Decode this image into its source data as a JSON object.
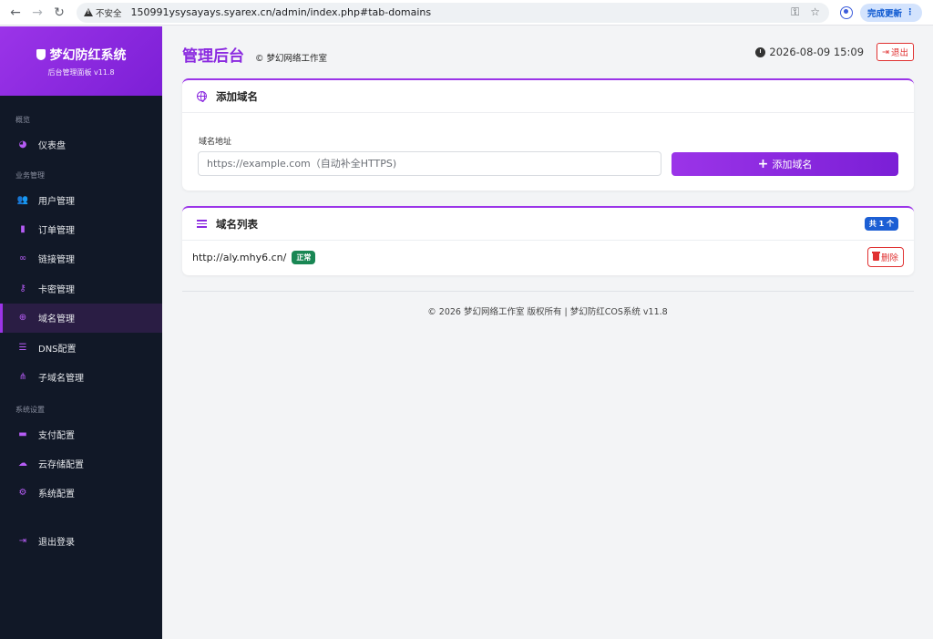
{
  "browser": {
    "insecure_label": "不安全",
    "url": "150991ysysayays.syarex.cn/admin/index.php#tab-domains",
    "update_label": "完成更新"
  },
  "brand": {
    "title": "梦幻防红系统",
    "subtitle": "后台管理面板 v11.8"
  },
  "sidebar": {
    "sections": [
      {
        "label": "概览",
        "items": [
          {
            "label": "仪表盘",
            "icon": "dashboard-icon",
            "glyph": "◕"
          }
        ]
      },
      {
        "label": "业务管理",
        "items": [
          {
            "label": "用户管理",
            "icon": "users-icon",
            "glyph": "👥"
          },
          {
            "label": "订单管理",
            "icon": "order-icon",
            "glyph": "▮"
          },
          {
            "label": "链接管理",
            "icon": "link-icon",
            "glyph": "∞"
          },
          {
            "label": "卡密管理",
            "icon": "key-icon",
            "glyph": "⚷"
          },
          {
            "label": "域名管理",
            "icon": "globe-icon",
            "glyph": "⊕",
            "active": true
          },
          {
            "label": "DNS配置",
            "icon": "server-icon",
            "glyph": "☰"
          },
          {
            "label": "子域名管理",
            "icon": "sitemap-icon",
            "glyph": "⋔"
          }
        ]
      },
      {
        "label": "系统设置",
        "items": [
          {
            "label": "支付配置",
            "icon": "credit-card-icon",
            "glyph": "▬"
          },
          {
            "label": "云存储配置",
            "icon": "cloud-icon",
            "glyph": "☁"
          },
          {
            "label": "系统配置",
            "icon": "cogs-icon",
            "glyph": "⚙"
          }
        ]
      }
    ],
    "logout": {
      "label": "退出登录",
      "icon": "sign-out-icon",
      "glyph": "⇥"
    }
  },
  "header": {
    "title": "管理后台",
    "subtitle": "© 梦幻网络工作室",
    "datetime": "2026-08-09 15:09",
    "logout_label": "退出"
  },
  "add_domain": {
    "title": "添加域名",
    "field_label": "域名地址",
    "placeholder": "https://example.com（自动补全HTTPS)",
    "button_label": "添加域名"
  },
  "domain_list": {
    "title": "域名列表",
    "count_label": "共 1 个",
    "rows": [
      {
        "url": "http://aly.mhy6.cn/",
        "status": "正常",
        "delete_label": "删除"
      }
    ]
  },
  "footer": {
    "text": "© 2026 梦幻网络工作室 版权所有 | 梦幻防红COS系统 v11.8"
  }
}
